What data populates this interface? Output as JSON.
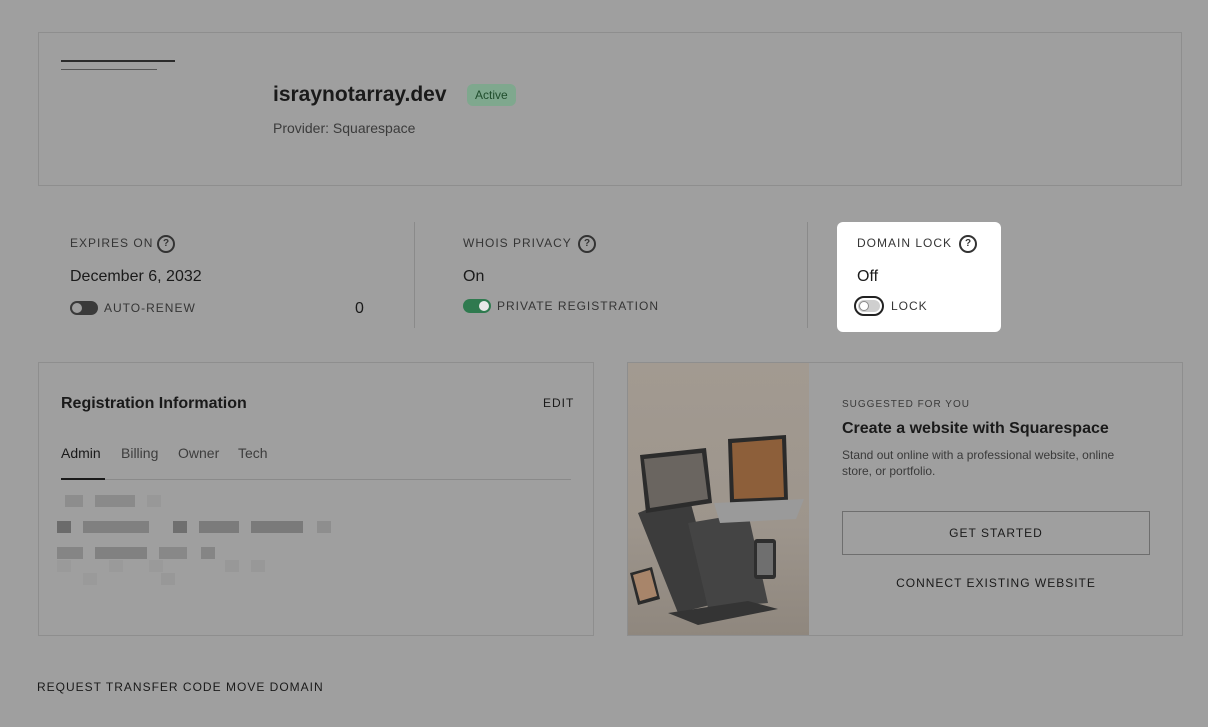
{
  "domain": {
    "name": "israynotarray.dev",
    "status": "Active",
    "provider": "Provider: Squarespace"
  },
  "expires": {
    "label": "EXPIRES ON",
    "value": "December 6, 2032",
    "toggle_label": "AUTO-RENEW",
    "auto_renew": false,
    "count": "0"
  },
  "whois": {
    "label": "WHOIS PRIVACY",
    "value": "On",
    "toggle_label": "PRIVATE REGISTRATION",
    "enabled": true
  },
  "lock": {
    "label": "DOMAIN LOCK",
    "value": "Off",
    "toggle_label": "LOCK",
    "enabled": false
  },
  "registration": {
    "title": "Registration Information",
    "edit_label": "EDIT",
    "tabs": [
      "Admin",
      "Billing",
      "Owner",
      "Tech"
    ],
    "active_tab": "Admin"
  },
  "suggestion": {
    "eyebrow": "SUGGESTED FOR YOU",
    "title": "Create a website with Squarespace",
    "description": "Stand out online with a professional website, online store, or portfolio.",
    "primary_button": "GET STARTED",
    "secondary_button": "CONNECT EXISTING WEBSITE"
  },
  "footer": {
    "transfer_label": "REQUEST TRANSFER CODE",
    "move_label": "MOVE DOMAIN"
  },
  "colors": {
    "backdrop": "#9f9f9f",
    "active_badge": "#7fa88e",
    "toggle_on": "#2f7a4f",
    "toggle_off": "#3a3a3a"
  }
}
